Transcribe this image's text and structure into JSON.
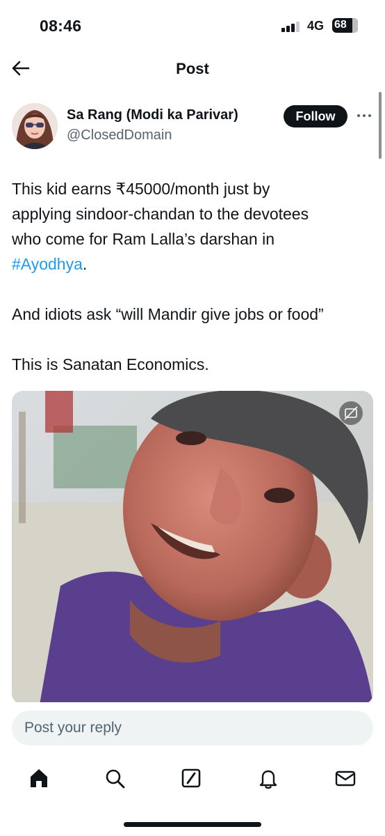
{
  "status_bar": {
    "time": "08:46",
    "network": "4G",
    "battery": "68",
    "signal_bars_active": 3
  },
  "header": {
    "title": "Post",
    "back_icon": "arrow-left-icon"
  },
  "post": {
    "author": {
      "name": "Sa Rang (Modi ka Parivar)",
      "handle": "@ClosedDomain",
      "avatar_icon": "profile-photo"
    },
    "follow_label": "Follow",
    "more_icon": "more-dots-icon",
    "text": {
      "line1": "This kid earns ₹45000/month just by",
      "line2": "applying sindoor-chandan to the devotees",
      "line3": "who come for Ram Lalla’s darshan in",
      "hashtag": "#Ayodhya",
      "hashtag_suffix": ".",
      "para2": "And idiots ask “will Mandir give jobs or food”",
      "para3": "This is Sanatan Economics."
    },
    "media": {
      "type": "video",
      "badge_icon": "captions-off-icon"
    }
  },
  "reply": {
    "placeholder": "Post your reply"
  },
  "nav": {
    "items": [
      "home-icon",
      "search-icon",
      "grok-icon",
      "notifications-bell-icon",
      "messages-mail-icon"
    ],
    "active": "home-icon"
  },
  "colors": {
    "text": "#0f1419",
    "secondary": "#536471",
    "link": "#1d9bf0",
    "input_bg": "#eff3f4"
  }
}
